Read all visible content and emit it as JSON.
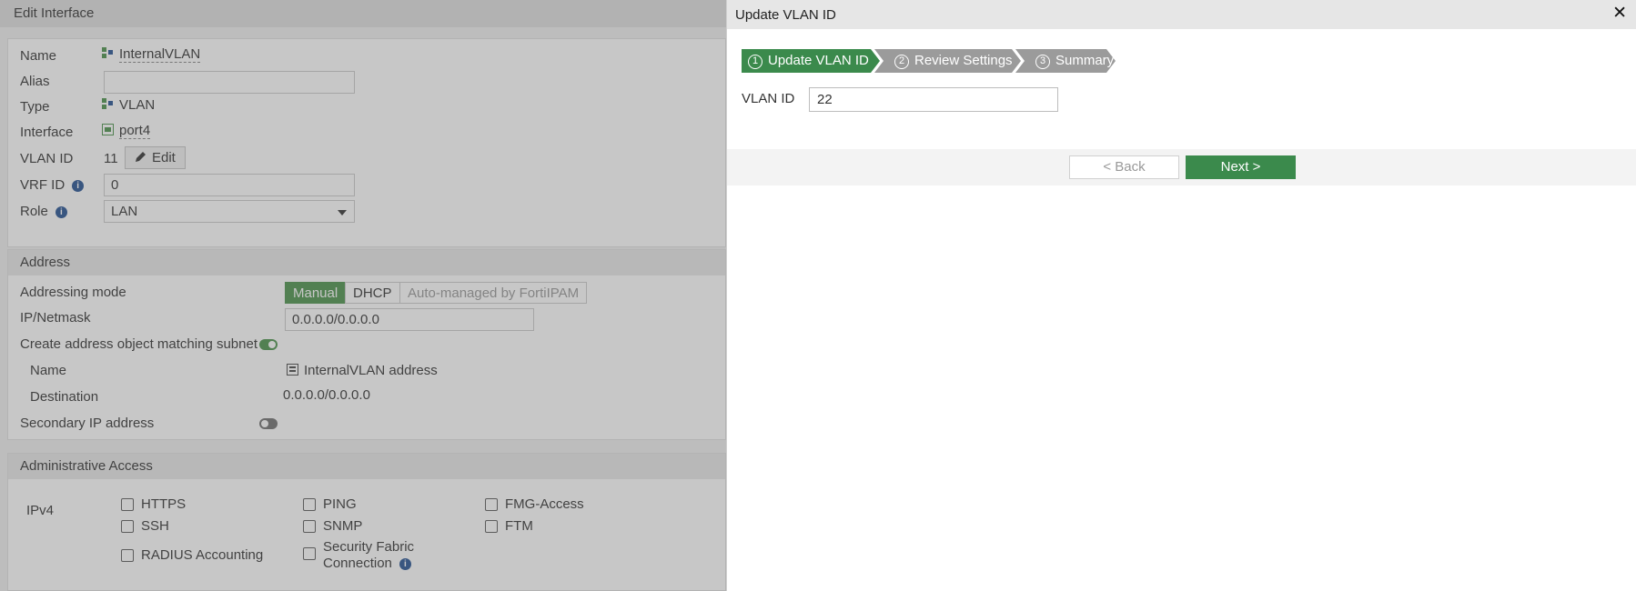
{
  "background": {
    "title": "Edit Interface",
    "general": {
      "name_label": "Name",
      "name_value": "InternalVLAN",
      "alias_label": "Alias",
      "alias_value": "",
      "type_label": "Type",
      "type_value": "VLAN",
      "interface_label": "Interface",
      "interface_value": "port4",
      "vlan_id_label": "VLAN ID",
      "vlan_id_value": "11",
      "edit_label": "Edit",
      "vrf_id_label": "VRF ID",
      "vrf_id_value": "0",
      "role_label": "Role",
      "role_value": "LAN"
    },
    "address": {
      "section_title": "Address",
      "addressing_mode_label": "Addressing mode",
      "modes": [
        "Manual",
        "DHCP",
        "Auto-managed by FortiIPAM"
      ],
      "active_mode": "Manual",
      "ip_netmask_label": "IP/Netmask",
      "ip_netmask_value": "0.0.0.0/0.0.0.0",
      "create_object_label": "Create address object matching subnet",
      "create_object_enabled": true,
      "name_label": "Name",
      "name_value": "InternalVLAN address",
      "destination_label": "Destination",
      "destination_value": "0.0.0.0/0.0.0.0",
      "secondary_ip_label": "Secondary IP address",
      "secondary_ip_enabled": false
    },
    "admin_access": {
      "section_title": "Administrative Access",
      "ipv4_label": "IPv4",
      "options": {
        "https": "HTTPS",
        "ping": "PING",
        "fmg_access": "FMG-Access",
        "ssh": "SSH",
        "snmp": "SNMP",
        "ftm": "FTM",
        "radius": "RADIUS Accounting",
        "sec_fabric_1": "Security Fabric",
        "sec_fabric_2": "Connection"
      }
    }
  },
  "dialog": {
    "title": "Update VLAN ID",
    "close_icon": "close-icon",
    "steps": [
      {
        "num": "1",
        "label": "Update VLAN ID",
        "active": true
      },
      {
        "num": "2",
        "label": "Review Settings",
        "active": false
      },
      {
        "num": "3",
        "label": "Summary",
        "active": false
      }
    ],
    "vlan_id_label": "VLAN ID",
    "vlan_id_value": "22",
    "back_label": "< Back",
    "next_label": "Next >"
  },
  "colors": {
    "accent_green": "#3b8a4c",
    "inactive_step": "#9b9b9b",
    "toggle_on": "#6aa56a"
  }
}
